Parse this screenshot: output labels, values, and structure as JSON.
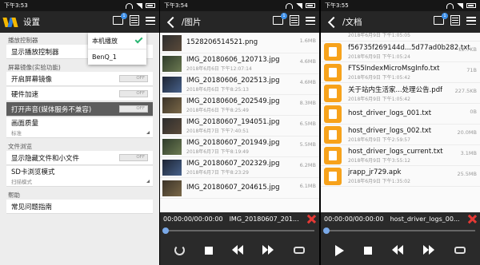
{
  "panel1": {
    "status_time": "下午3:53",
    "title": "设置",
    "cast_badge": "1",
    "popup": [
      "本机播放",
      "BenQ_1"
    ],
    "sections": [
      {
        "label": "播放控制器",
        "rows": [
          {
            "label": "显示播放控制器"
          }
        ]
      },
      {
        "label": "屏幕镜像(实验功能)",
        "rows": [
          {
            "label": "开启屏幕镜像",
            "toggle": "OFF"
          },
          {
            "label": "硬件加速",
            "toggle": "OFF"
          },
          {
            "label": "打开声音(媒体服务不兼容)",
            "toggle": "OFF"
          },
          {
            "label": "画面质量",
            "sub": "标准"
          }
        ]
      },
      {
        "label": "文件浏览",
        "rows": [
          {
            "label": "显示隐藏文件和小文件",
            "toggle": "OFF"
          },
          {
            "label": "SD卡浏览模式",
            "sub": "扫描模式"
          }
        ]
      },
      {
        "label": "帮助",
        "rows": [
          {
            "label": "常见问题指南"
          }
        ]
      }
    ]
  },
  "panel2": {
    "status_time": "下午3:54",
    "title": "/图片",
    "cast_badge": "1",
    "files": [
      {
        "name": "1528206514521.png",
        "date": "",
        "size": "1.6MB"
      },
      {
        "name": "IMG_20180606_120713.jpg",
        "date": "2018年6月6日 下午12:07:14",
        "size": "4.6MB"
      },
      {
        "name": "IMG_20180606_202513.jpg",
        "date": "2018年6月6日 下午8:25:13",
        "size": "4.6MB"
      },
      {
        "name": "IMG_20180606_202549.jpg",
        "date": "2018年6月6日 下午8:25:49",
        "size": "8.3MB"
      },
      {
        "name": "IMG_20180607_194051.jpg",
        "date": "2018年6月7日 下午7:40:51",
        "size": "6.5MB"
      },
      {
        "name": "IMG_20180607_201949.jpg",
        "date": "2018年6月7日 下午8:19:49",
        "size": "5.5MB"
      },
      {
        "name": "IMG_20180607_202329.jpg",
        "date": "2018年6月7日 下午8:23:29",
        "size": "6.2MB"
      },
      {
        "name": "IMG_20180607_204615.jpg",
        "date": "",
        "size": "6.1MB"
      }
    ],
    "player": {
      "time": "00:00:00/00:00:00",
      "title": "IMG_20180607_201..."
    }
  },
  "panel3": {
    "status_time": "下午3:55",
    "title": "/文档",
    "cast_badge": "1",
    "files": [
      {
        "name": "",
        "date": "2018年6月9日 下午1:05:05",
        "size": ""
      },
      {
        "name": "f56735f269144d...5d77ad0b282.txt",
        "date": "2018年6月9日 下午1:05:24",
        "size": "12.7KB"
      },
      {
        "name": "FTS5IndexMicroMsgInfo.txt",
        "date": "2018年6月9日 下午1:05:42",
        "size": "71B"
      },
      {
        "name": "关于站内生活家...处理公告.pdf",
        "date": "2018年6月9日 下午1:05:42",
        "size": "227.5KB"
      },
      {
        "name": "host_driver_logs_001.txt",
        "date": "",
        "size": "0B"
      },
      {
        "name": "host_driver_logs_002.txt",
        "date": "2018年6月9日 下午2:59:57",
        "size": "20.0MB"
      },
      {
        "name": "host_driver_logs_current.txt",
        "date": "2018年6月9日 下午3:55:12",
        "size": "3.1MB"
      },
      {
        "name": "jrapp_jr729.apk",
        "date": "2018年6月9日 下午1:35:02",
        "size": "25.5MB"
      }
    ],
    "player": {
      "time": "00:00:00/00:00:00",
      "title": "host_driver_logs_00..."
    }
  }
}
